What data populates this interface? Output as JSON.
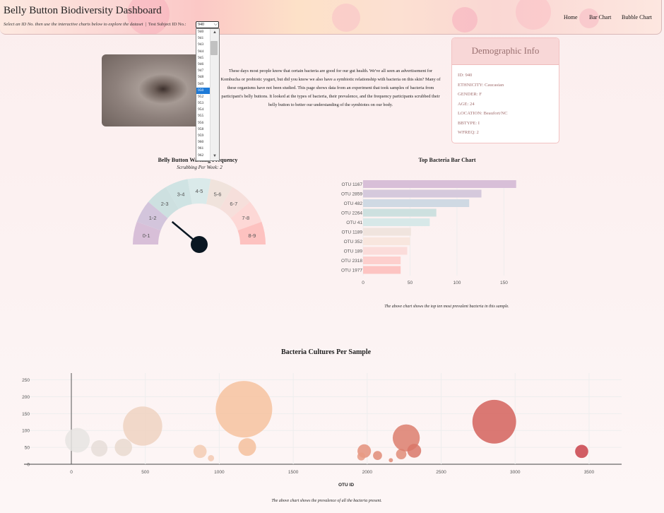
{
  "header": {
    "title": "Belly Button Biodiversity Dashboard",
    "instruction": "Select an ID No. then use the interactive charts below to explore the dataset",
    "separator": "|",
    "id_label": "Test Subject ID No.:",
    "selected_id": "940",
    "nav": [
      "Home",
      "Bar Chart",
      "Bubble Chart"
    ]
  },
  "dropdown": {
    "options": [
      "940",
      "941",
      "943",
      "944",
      "945",
      "946",
      "947",
      "948",
      "949",
      "950",
      "952",
      "953",
      "954",
      "955",
      "956",
      "958",
      "959",
      "960",
      "961",
      "962"
    ],
    "highlighted": "950"
  },
  "intro_text": "These days most people know that certain bacteria are good for our gut health. We've all seen an advertisement for Kombucha or probiotic yogurt, but did you know we also have a symbiotic relationship with bacteria on this skin? Many of these organisms have not been studied. This page shows data from an experiment that took samples of bacteria from participant's belly buttons. It looked at the types of bacteria, their prevalence, and the frequency participants scrubbed their belly button to better our understanding of the symbiotes on our body.",
  "demographic": {
    "title": "Demographic Info",
    "rows": [
      "ID: 940",
      "ETHNICITY: Caucasian",
      "GENDER: F",
      "AGE: 24",
      "LOCATION: Beaufort/NC",
      "BBTYPE: I",
      "WFREQ: 2"
    ]
  },
  "gauge": {
    "title": "Belly Button Washing Frequency",
    "subtitle": "Scrubbing Per Week: 2",
    "segments": [
      "0-1",
      "1-2",
      "2-3",
      "3-4",
      "4-5",
      "5-6",
      "6-7",
      "7-8",
      "8-9"
    ],
    "colors": [
      "#d8bfd8",
      "#d3c5dc",
      "#cde0e0",
      "#cfe3e3",
      "#daeaea",
      "#f0e3dc",
      "#f6dfdb",
      "#fdd8d6",
      "#fdc2c0"
    ],
    "value": 2
  },
  "bar_chart": {
    "title": "Top Bacteria Bar Chart",
    "caption": "The above chart shows the top ten most prevalent bacteria in this sample."
  },
  "bubble_chart": {
    "title": "Bacteria Cultures Per Sample",
    "caption": "The above chart shows the prevalence of all the bacteria present."
  },
  "chart_data": [
    {
      "type": "bar",
      "orientation": "horizontal",
      "categories": [
        "OTU 1167",
        "OTU 2859",
        "OTU 482",
        "OTU 2264",
        "OTU 41",
        "OTU 1189",
        "OTU 352",
        "OTU 189",
        "OTU 2318",
        "OTU 1977"
      ],
      "values": [
        163,
        126,
        113,
        78,
        71,
        51,
        50,
        47,
        40,
        40
      ],
      "colors": [
        "#d8bfd8",
        "#d5c9dc",
        "#cfd9e3",
        "#cde0df",
        "#d7e8e8",
        "#f0e4de",
        "#f8e6de",
        "#fbdcda",
        "#fdcfcd",
        "#fdc4c2"
      ],
      "xticks": [
        0,
        50,
        100,
        150
      ],
      "xlim": [
        0,
        170
      ]
    },
    {
      "type": "scatter",
      "subtype": "bubble",
      "xlabel": "OTU ID",
      "xticks": [
        0,
        500,
        1000,
        1500,
        2000,
        2500,
        3000,
        3500
      ],
      "yticks": [
        0,
        50,
        100,
        150,
        200,
        250
      ],
      "xlim": [
        -320,
        3720
      ],
      "ylim": [
        0,
        270
      ],
      "points": [
        {
          "x": 41,
          "y": 71,
          "size": 71,
          "color": "#e6e4e2"
        },
        {
          "x": 189,
          "y": 47,
          "size": 47,
          "color": "#e6ddd8"
        },
        {
          "x": 352,
          "y": 50,
          "size": 50,
          "color": "#e9d9cf"
        },
        {
          "x": 482,
          "y": 113,
          "size": 113,
          "color": "#efd2c1"
        },
        {
          "x": 870,
          "y": 38,
          "size": 38,
          "color": "#f3cbb3"
        },
        {
          "x": 944,
          "y": 18,
          "size": 18,
          "color": "#f3c9b1"
        },
        {
          "x": 1167,
          "y": 163,
          "size": 163,
          "color": "#f6c29f"
        },
        {
          "x": 1189,
          "y": 51,
          "size": 51,
          "color": "#f4bf9c"
        },
        {
          "x": 1980,
          "y": 39,
          "size": 39,
          "color": "#e4917b"
        },
        {
          "x": 1960,
          "y": 23,
          "size": 23,
          "color": "#e89a84"
        },
        {
          "x": 2070,
          "y": 26,
          "size": 26,
          "color": "#e08c78"
        },
        {
          "x": 2160,
          "y": 12,
          "size": 12,
          "color": "#e08c78"
        },
        {
          "x": 2230,
          "y": 30,
          "size": 30,
          "color": "#e08c78"
        },
        {
          "x": 2264,
          "y": 78,
          "size": 78,
          "color": "#dc7e6d"
        },
        {
          "x": 2318,
          "y": 40,
          "size": 40,
          "color": "#d97769"
        },
        {
          "x": 2859,
          "y": 126,
          "size": 126,
          "color": "#d4625c"
        },
        {
          "x": 3450,
          "y": 38,
          "size": 38,
          "color": "#c9424a"
        }
      ]
    }
  ]
}
